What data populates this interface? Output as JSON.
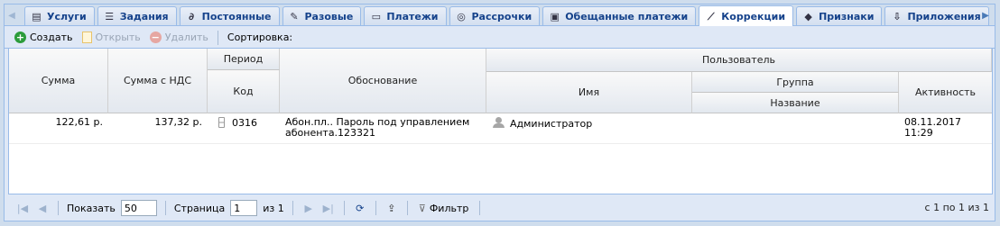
{
  "tabs": [
    {
      "label": "Услуги",
      "icon": "receipt-icon"
    },
    {
      "label": "Задания",
      "icon": "tasks-icon"
    },
    {
      "label": "Постоянные",
      "icon": "link-icon"
    },
    {
      "label": "Разовые",
      "icon": "wrench-icon"
    },
    {
      "label": "Платежи",
      "icon": "card-icon"
    },
    {
      "label": "Рассрочки",
      "icon": "lifebuoy-icon"
    },
    {
      "label": "Обещанные платежи",
      "icon": "promise-icon"
    },
    {
      "label": "Коррекции",
      "icon": "wand-icon"
    },
    {
      "label": "Признаки",
      "icon": "tag-icon"
    },
    {
      "label": "Приложения",
      "icon": "attachment-icon"
    }
  ],
  "active_tab": "Коррекции",
  "toolbar": {
    "create": "Создать",
    "open": "Открыть",
    "delete": "Удалить",
    "sort": "Сортировка:"
  },
  "columns": {
    "sum": "Сумма",
    "sum_vat": "Сумма с НДС",
    "period": "Период",
    "code": "Код",
    "reason": "Обоснование",
    "user": "Пользователь",
    "name": "Имя",
    "group": "Группа",
    "group_name": "Название",
    "activity": "Активность"
  },
  "rows": [
    {
      "sum": "122,61 р.",
      "sum_vat": "137,32 р.",
      "code": "0316",
      "reason_line1": "Абон.пл.. Пароль под управлением",
      "reason_line2": "абонента.123321",
      "user": "Администратор",
      "group_name": "",
      "activity": "08.11.2017 11:29"
    }
  ],
  "pager": {
    "show": "Показать",
    "page_size": "50",
    "page": "Страница",
    "page_num": "1",
    "of": "из 1",
    "filter": "Фильтр",
    "info": "с 1 по 1 из 1"
  }
}
